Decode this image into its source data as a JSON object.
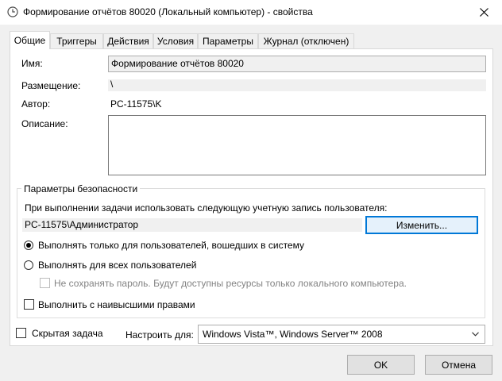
{
  "window": {
    "title": "Формирование отчётов 80020 (Локальный компьютер) - свойства",
    "icon": "clock-icon",
    "close_glyph": "✕"
  },
  "tabs": [
    {
      "label": "Общие",
      "active": true
    },
    {
      "label": "Триггеры",
      "active": false
    },
    {
      "label": "Действия",
      "active": false
    },
    {
      "label": "Условия",
      "active": false
    },
    {
      "label": "Параметры",
      "active": false
    },
    {
      "label": "Журнал (отключен)",
      "active": false
    }
  ],
  "general": {
    "name_label": "Имя:",
    "name_value": "Формирование отчётов 80020",
    "location_label": "Размещение:",
    "location_value": "\\",
    "author_label": "Автор:",
    "author_value": "PC-11575\\K",
    "description_label": "Описание:",
    "description_value": ""
  },
  "security": {
    "legend": "Параметры безопасности",
    "account_prompt": "При выполнении задачи использовать следующую учетную запись пользователя:",
    "account_value": "PC-11575\\Администратор",
    "change_button": "Изменить...",
    "radio_logged_on": "Выполнять только для пользователей, вошедших в систему",
    "radio_any_user": "Выполнять для всех пользователей",
    "no_store_password": "Не сохранять пароль. Будут доступны ресурсы только локального компьютера.",
    "highest_privileges": "Выполнить с наивысшими правами",
    "selected_radio": "logged_on"
  },
  "bottom": {
    "hidden_label": "Скрытая задача",
    "configure_label": "Настроить для:",
    "configure_value": "Windows Vista™, Windows Server™ 2008"
  },
  "buttons": {
    "ok": "OK",
    "cancel": "Отмена"
  },
  "colors": {
    "accent": "#0078d7",
    "window_bg": "#f0f0f0",
    "panel_bg": "#ffffff"
  }
}
